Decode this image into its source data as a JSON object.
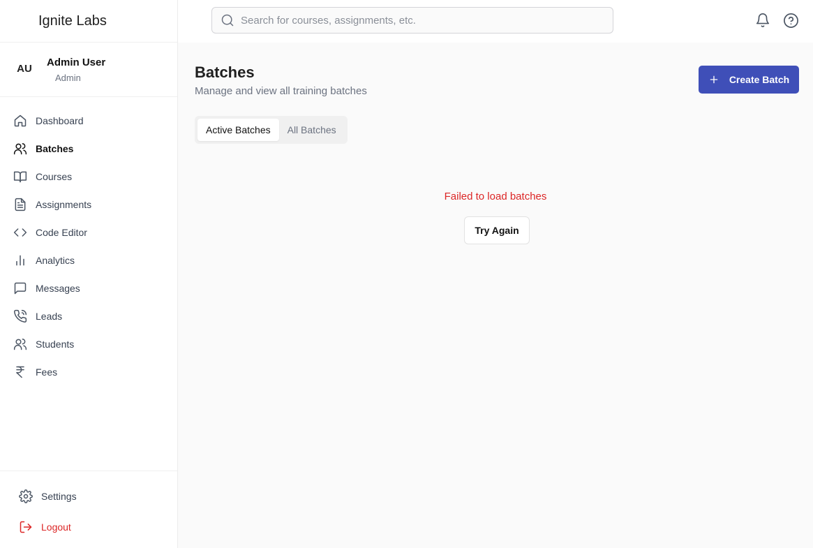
{
  "app": {
    "brand": "Ignite Labs"
  },
  "user": {
    "initials": "AU",
    "name": "Admin User",
    "role": "Admin"
  },
  "search": {
    "placeholder": "Search for courses, assignments, etc.",
    "value": ""
  },
  "sidebar": {
    "items": [
      {
        "label": "Dashboard",
        "icon": "home-icon",
        "active": false
      },
      {
        "label": "Batches",
        "icon": "users-icon",
        "active": true
      },
      {
        "label": "Courses",
        "icon": "book-open-icon",
        "active": false
      },
      {
        "label": "Assignments",
        "icon": "file-text-icon",
        "active": false
      },
      {
        "label": "Code Editor",
        "icon": "code-icon",
        "active": false
      },
      {
        "label": "Analytics",
        "icon": "bar-chart-icon",
        "active": false
      },
      {
        "label": "Messages",
        "icon": "message-square-icon",
        "active": false
      },
      {
        "label": "Leads",
        "icon": "phone-call-icon",
        "active": false
      },
      {
        "label": "Students",
        "icon": "users-icon",
        "active": false
      },
      {
        "label": "Fees",
        "icon": "rupee-icon",
        "active": false
      }
    ],
    "bottom": [
      {
        "label": "Settings",
        "icon": "gear-icon"
      },
      {
        "label": "Logout",
        "icon": "logout-icon"
      }
    ]
  },
  "header": {
    "icons": [
      "bell-icon",
      "help-circle-icon"
    ]
  },
  "page": {
    "title": "Batches",
    "subtitle": "Manage and view all training batches",
    "create_label": "Create Batch",
    "tabs": [
      {
        "label": "Active Batches",
        "active": true
      },
      {
        "label": "All Batches",
        "active": false
      }
    ],
    "error": "Failed to load batches",
    "retry_label": "Try Again"
  },
  "colors": {
    "primary": "#3f4fb8",
    "danger": "#dc2626"
  }
}
